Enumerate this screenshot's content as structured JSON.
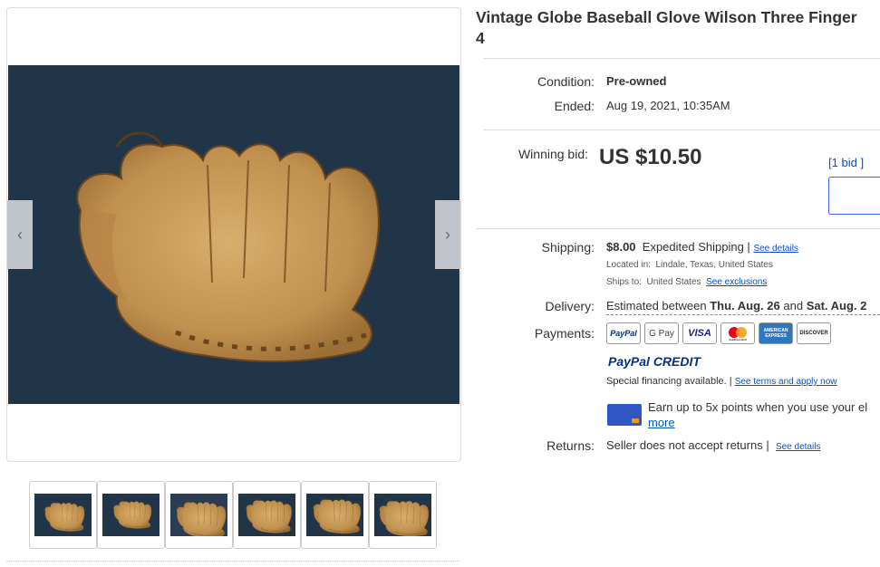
{
  "listing": {
    "title_line1": "Vintage Globe Baseball Glove Wilson Three Finger",
    "title_line2": "4"
  },
  "gallery": {
    "prev_arrow": "‹",
    "next_arrow": "›",
    "thumbnail_count": 6
  },
  "details": {
    "condition_label": "Condition:",
    "condition_value": "Pre-owned",
    "ended_label": "Ended:",
    "ended_value": "Aug 19, 2021, 10:35AM"
  },
  "bid": {
    "winning_label": "Winning bid:",
    "amount": "US $10.50",
    "bid_count_open": "[",
    "bid_count_link": "1 bid",
    "bid_count_close": "]"
  },
  "shipping": {
    "label": "Shipping:",
    "price": "$8.00",
    "method": "Expedited Shipping |",
    "see_details": "See details",
    "located_label": "Located in:",
    "located_value": "Lindale, Texas, United States",
    "ships_label": "Ships to:",
    "ships_value": "United States",
    "see_exclusions": "See exclusions"
  },
  "delivery": {
    "label": "Delivery:",
    "prefix": "Estimated between",
    "date1": "Thu. Aug. 26",
    "and": "and",
    "date2": "Sat. Aug. 2"
  },
  "payments": {
    "label": "Payments:",
    "methods": [
      "PayPal",
      "G Pay",
      "VISA",
      "mastercard",
      "AMERICAN EXPRESS",
      "DISCOVER"
    ],
    "paypal_credit": "PayPal CREDIT",
    "financing_text": "Special financing available.",
    "terms_link": "See terms and apply now",
    "points_text": "Earn up to 5x points when you use your el",
    "more_link": "more"
  },
  "returns": {
    "label": "Returns:",
    "value": "Seller does not accept returns |",
    "see_details": "See details"
  },
  "colors": {
    "link": "#0654ba",
    "photo_bg": "#213549",
    "glove": "#c99a55"
  }
}
